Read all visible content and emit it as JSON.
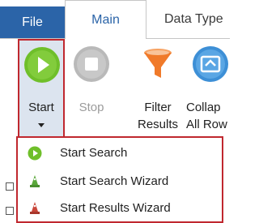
{
  "tabs": {
    "file": "File",
    "main": "Main",
    "data_type": "Data Type"
  },
  "ribbon": {
    "start": {
      "label": "Start",
      "icon": "play-circle-icon",
      "color": "#6fbf2a"
    },
    "stop": {
      "label": "Stop",
      "icon": "stop-circle-icon",
      "color": "#b9b9b9"
    },
    "filter_results": {
      "line1": "Filter",
      "line2": "Results",
      "icon": "funnel-icon",
      "color": "#f07a2a"
    },
    "collapse_all_rows": {
      "line1": "Collap",
      "line2": "All Row",
      "icon": "collapse-rows-icon",
      "color": "#3d8fd6"
    }
  },
  "start_menu": {
    "items": [
      {
        "label": "Start Search",
        "icon": "play-circle-icon"
      },
      {
        "label": "Start Search Wizard",
        "icon": "wizard-green-icon"
      },
      {
        "label": "Start Results Wizard",
        "icon": "wizard-red-icon"
      }
    ]
  },
  "colors": {
    "file_tab": "#2b64a8",
    "highlight_border": "#c0282f",
    "start_hover_bg": "#dce4ef"
  }
}
